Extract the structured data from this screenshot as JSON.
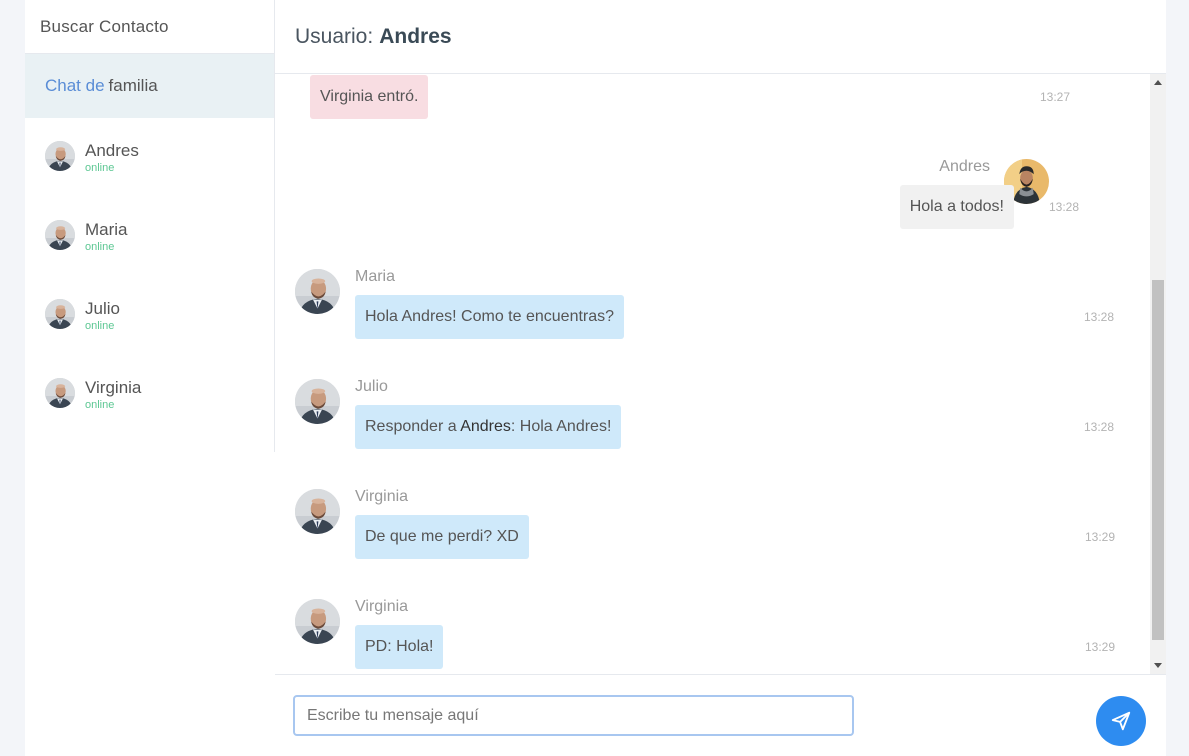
{
  "sidebar": {
    "search_label": "Buscar Contacto",
    "group": {
      "prefix": "Chat de",
      "name": "familia"
    },
    "contacts": [
      {
        "name": "Andres",
        "status": "online"
      },
      {
        "name": "Maria",
        "status": "online"
      },
      {
        "name": "Julio",
        "status": "online"
      },
      {
        "name": "Virginia",
        "status": "online"
      }
    ]
  },
  "header": {
    "label": "Usuario:",
    "user": "Andres"
  },
  "messages": [
    {
      "type": "system",
      "text": "Virginia entró.",
      "time": "13:27"
    },
    {
      "type": "own",
      "sender": "Andres",
      "text": "Hola a todos!",
      "time": "13:28"
    },
    {
      "type": "other",
      "sender": "Maria",
      "text": "Hola Andres! Como te encuentras?",
      "time": "13:28"
    },
    {
      "type": "reply",
      "sender": "Julio",
      "text_pre": "Responder a",
      "mention": "Andres",
      "text_post": ": Hola Andres!",
      "time": "13:28"
    },
    {
      "type": "other",
      "sender": "Virginia",
      "text": "De que me perdi? XD",
      "time": "13:29"
    },
    {
      "type": "other",
      "sender": "Virginia",
      "text": "PD: Hola!",
      "time": "13:29"
    }
  ],
  "composer": {
    "placeholder": "Escribe tu mensaje aquí",
    "value": ""
  },
  "colors": {
    "accent": "#2e8cf0",
    "online": "#5dc793",
    "bubble_other": "#cfe9fa",
    "bubble_own": "#f1f1f1",
    "bubble_system": "#f8dde2"
  }
}
